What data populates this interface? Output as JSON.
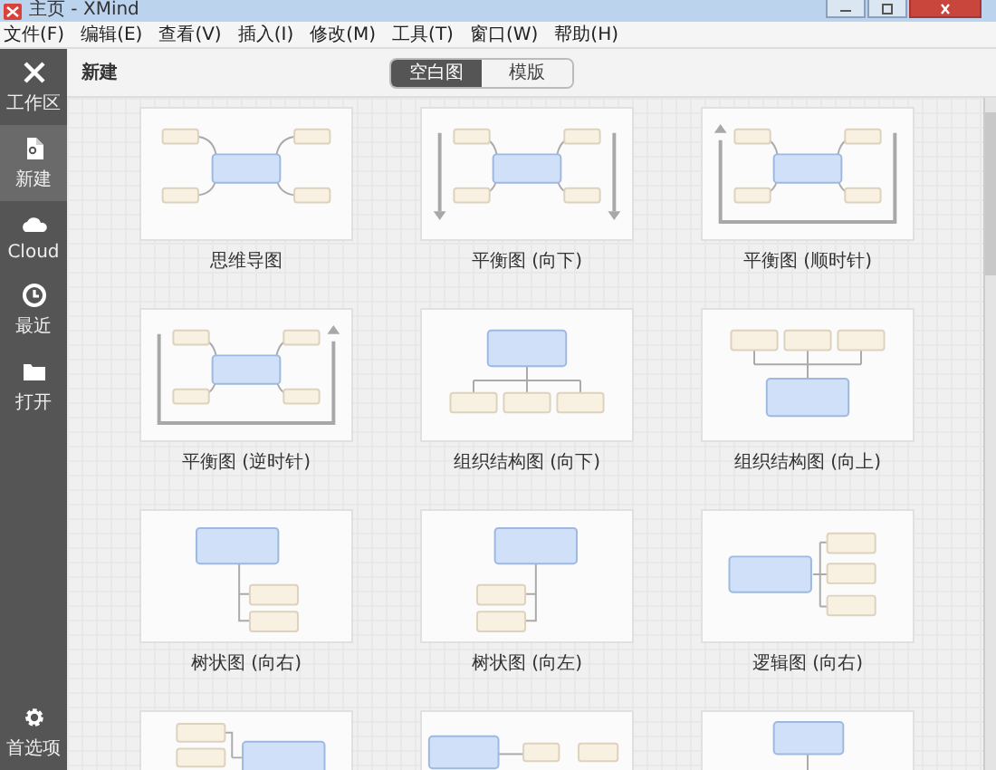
{
  "window": {
    "title": "主页 - XMind"
  },
  "menu": [
    "文件(F)",
    "编辑(E)",
    "查看(V)",
    "插入(I)",
    "修改(M)",
    "工具(T)",
    "窗口(W)",
    "帮助(H)"
  ],
  "sidebar": {
    "items": [
      {
        "label": "工作区",
        "kind": "cross",
        "selected": false
      },
      {
        "label": "新建",
        "kind": "file",
        "selected": true
      },
      {
        "label": "Cloud",
        "kind": "cloud",
        "selected": false
      },
      {
        "label": "最近",
        "kind": "clock",
        "selected": false
      },
      {
        "label": "打开",
        "kind": "folder",
        "selected": false
      }
    ],
    "footer": {
      "label": "首选项",
      "kind": "gear"
    }
  },
  "header": {
    "title": "新建",
    "tabs": [
      {
        "label": "空白图",
        "selected": true
      },
      {
        "label": "模版",
        "selected": false
      }
    ]
  },
  "templates": [
    {
      "kind": "mindmap",
      "label": "思维导图"
    },
    {
      "kind": "balance-down",
      "label": "平衡图 (向下)"
    },
    {
      "kind": "balance-cw",
      "label": "平衡图 (顺时针)"
    },
    {
      "kind": "balance-ccw",
      "label": "平衡图 (逆时针)"
    },
    {
      "kind": "org-down",
      "label": "组织结构图 (向下)"
    },
    {
      "kind": "org-up",
      "label": "组织结构图 (向上)"
    },
    {
      "kind": "tree-right",
      "label": "树状图 (向右)"
    },
    {
      "kind": "tree-left",
      "label": "树状图 (向左)"
    },
    {
      "kind": "logic-right",
      "label": "逻辑图 (向右)"
    },
    {
      "kind": "logic-left"
    },
    {
      "kind": "timeline"
    },
    {
      "kind": "org-vertical"
    }
  ]
}
